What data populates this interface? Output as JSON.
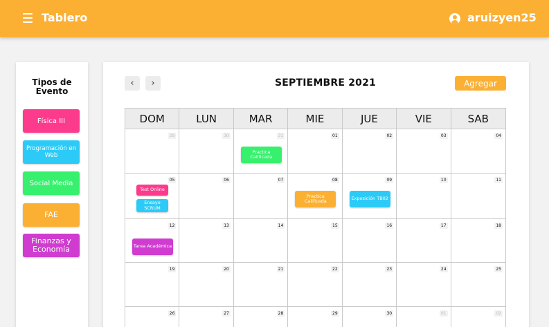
{
  "header": {
    "title": "Tablero",
    "menu_icon": "hamburger-menu-icon",
    "user_icon": "user-circle-icon",
    "username": "aruizyen25",
    "color": "#fbb034"
  },
  "sidebar": {
    "title": "Tipos de Evento",
    "types": [
      {
        "label": "Física III",
        "color": "#fd3b8d"
      },
      {
        "label": "Programación en Web",
        "color": "#2ccbf7"
      },
      {
        "label": "Social Media",
        "color": "#37f06d"
      },
      {
        "label": "FAE",
        "color": "#fbb034"
      },
      {
        "label": "Finanzas y Economía",
        "color": "#cf3ccf"
      }
    ]
  },
  "calendar": {
    "month_label": "SEPTIEMBRE 2021",
    "prev_icon": "chevron-left-icon",
    "next_icon": "chevron-right-icon",
    "prev_symbol": "‹",
    "next_symbol": "›",
    "add_label": "Agregar",
    "days": [
      "DOM",
      "LUN",
      "MAR",
      "MIE",
      "JUE",
      "VIE",
      "SAB"
    ],
    "weeks": [
      [
        {
          "n": "29",
          "muted": true
        },
        {
          "n": "30",
          "muted": true
        },
        {
          "n": "31",
          "muted": true,
          "events": [
            {
              "title": "Practica Calificada",
              "type": 2
            }
          ]
        },
        {
          "n": "01"
        },
        {
          "n": "02"
        },
        {
          "n": "03"
        },
        {
          "n": "04"
        }
      ],
      [
        {
          "n": "05",
          "events": [
            {
              "title": "Test Online",
              "type": 0
            },
            {
              "title": "Ensayo SCRUM",
              "type": 1
            }
          ]
        },
        {
          "n": "06"
        },
        {
          "n": "07"
        },
        {
          "n": "08",
          "events": [
            {
              "title": "Practica Calificada",
              "type": 3
            }
          ]
        },
        {
          "n": "09",
          "events": [
            {
              "title": "Exposición TB02",
              "type": 1
            }
          ]
        },
        {
          "n": "10"
        },
        {
          "n": "11"
        }
      ],
      [
        {
          "n": "12",
          "events": [
            {
              "title": "Tarea Académica",
              "type": 4
            }
          ]
        },
        {
          "n": "13"
        },
        {
          "n": "14"
        },
        {
          "n": "15"
        },
        {
          "n": "16"
        },
        {
          "n": "17"
        },
        {
          "n": "18"
        }
      ],
      [
        {
          "n": "19"
        },
        {
          "n": "20"
        },
        {
          "n": "21"
        },
        {
          "n": "22"
        },
        {
          "n": "23"
        },
        {
          "n": "24"
        },
        {
          "n": "25"
        }
      ],
      [
        {
          "n": "26"
        },
        {
          "n": "27"
        },
        {
          "n": "28"
        },
        {
          "n": "29"
        },
        {
          "n": "30"
        },
        {
          "n": "01",
          "muted": true
        },
        {
          "n": "02",
          "muted": true
        }
      ]
    ]
  }
}
